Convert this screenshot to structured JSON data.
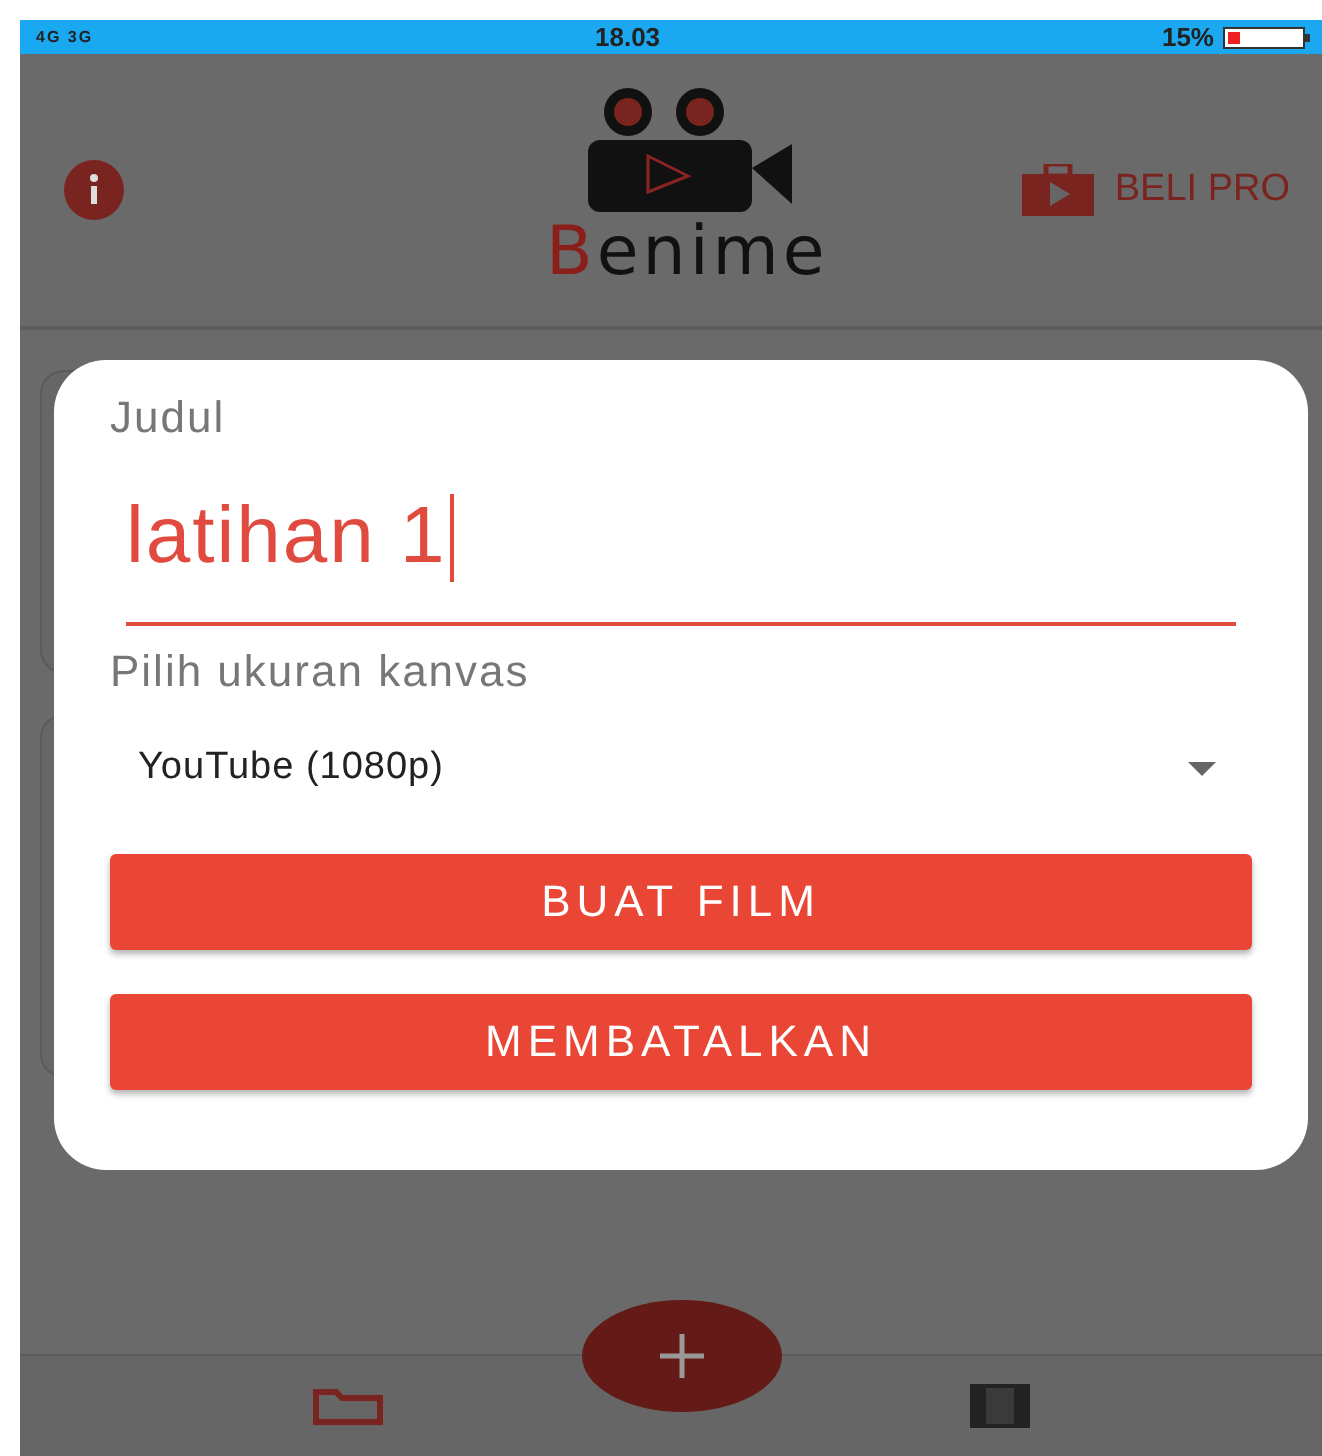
{
  "status_bar": {
    "network": "4G 3G",
    "time": "18.03",
    "battery": "15%"
  },
  "header": {
    "logo": "Benime",
    "pro_button": "BELI PRO"
  },
  "dialog": {
    "title_label": "Judul",
    "title_value": "latihan 1",
    "canvas_label": "Pilih ukuran kanvas",
    "canvas_value": "YouTube (1080p)",
    "buttons": [
      {
        "label": "BUAT FILM"
      },
      {
        "label": "MEMBATALKAN"
      }
    ]
  },
  "bottom_nav": [
    {
      "kind": "folder",
      "selected": true
    },
    {
      "kind": "film",
      "selected": false
    }
  ]
}
